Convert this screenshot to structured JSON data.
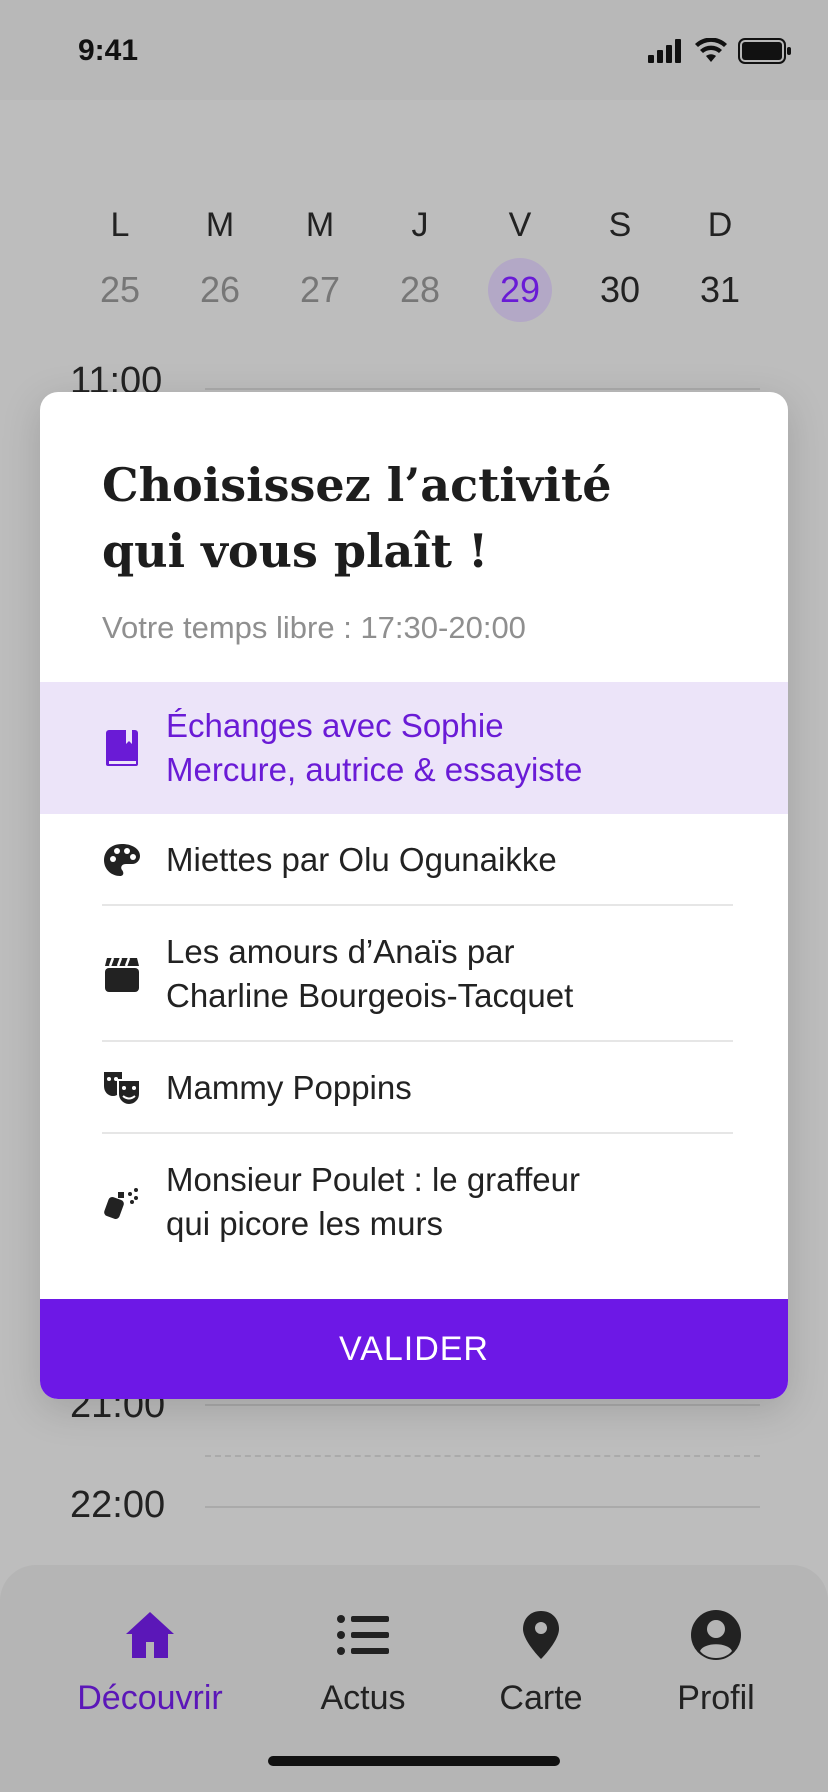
{
  "status_bar": {
    "time": "9:41"
  },
  "week": {
    "days": [
      {
        "letter": "L",
        "num": "25"
      },
      {
        "letter": "M",
        "num": "26"
      },
      {
        "letter": "M",
        "num": "27"
      },
      {
        "letter": "J",
        "num": "28"
      },
      {
        "letter": "V",
        "num": "29"
      },
      {
        "letter": "S",
        "num": "30"
      },
      {
        "letter": "D",
        "num": "31"
      }
    ],
    "selected_index": 4
  },
  "timeline": {
    "labels": [
      "11:00",
      "21:00",
      "22:00"
    ]
  },
  "modal": {
    "title_line1": "Choisissez l’activité",
    "title_line2": "qui vous plaît !",
    "subtitle": "Votre temps libre : 17:30-20:00",
    "activities": [
      {
        "line1": "Échanges avec Sophie",
        "line2": "Mercure, autrice & essayiste",
        "icon": "book-icon",
        "selected": true
      },
      {
        "line1": "Miettes par Olu Ogunaikke",
        "line2": "",
        "icon": "palette-icon",
        "selected": false
      },
      {
        "line1": "Les amours d’Anaïs par",
        "line2": "Charline Bourgeois-Tacquet",
        "icon": "clapperboard-icon",
        "selected": false
      },
      {
        "line1": "Mammy Poppins",
        "line2": "",
        "icon": "theater-masks-icon",
        "selected": false
      },
      {
        "line1": "Monsieur Poulet : le graffeur",
        "line2": "qui picore les murs",
        "icon": "spray-can-icon",
        "selected": false
      }
    ],
    "validate_label": "VALIDER"
  },
  "tabbar": {
    "tabs": [
      {
        "label": "Découvrir",
        "icon": "home-icon",
        "active": true
      },
      {
        "label": "Actus",
        "icon": "list-icon",
        "active": false
      },
      {
        "label": "Carte",
        "icon": "map-pin-icon",
        "active": false
      },
      {
        "label": "Profil",
        "icon": "user-circle-icon",
        "active": false
      }
    ]
  },
  "colors": {
    "accent": "#6d18e6",
    "selected_bg": "#ece4f9",
    "selected_text": "#6a1bd6"
  }
}
